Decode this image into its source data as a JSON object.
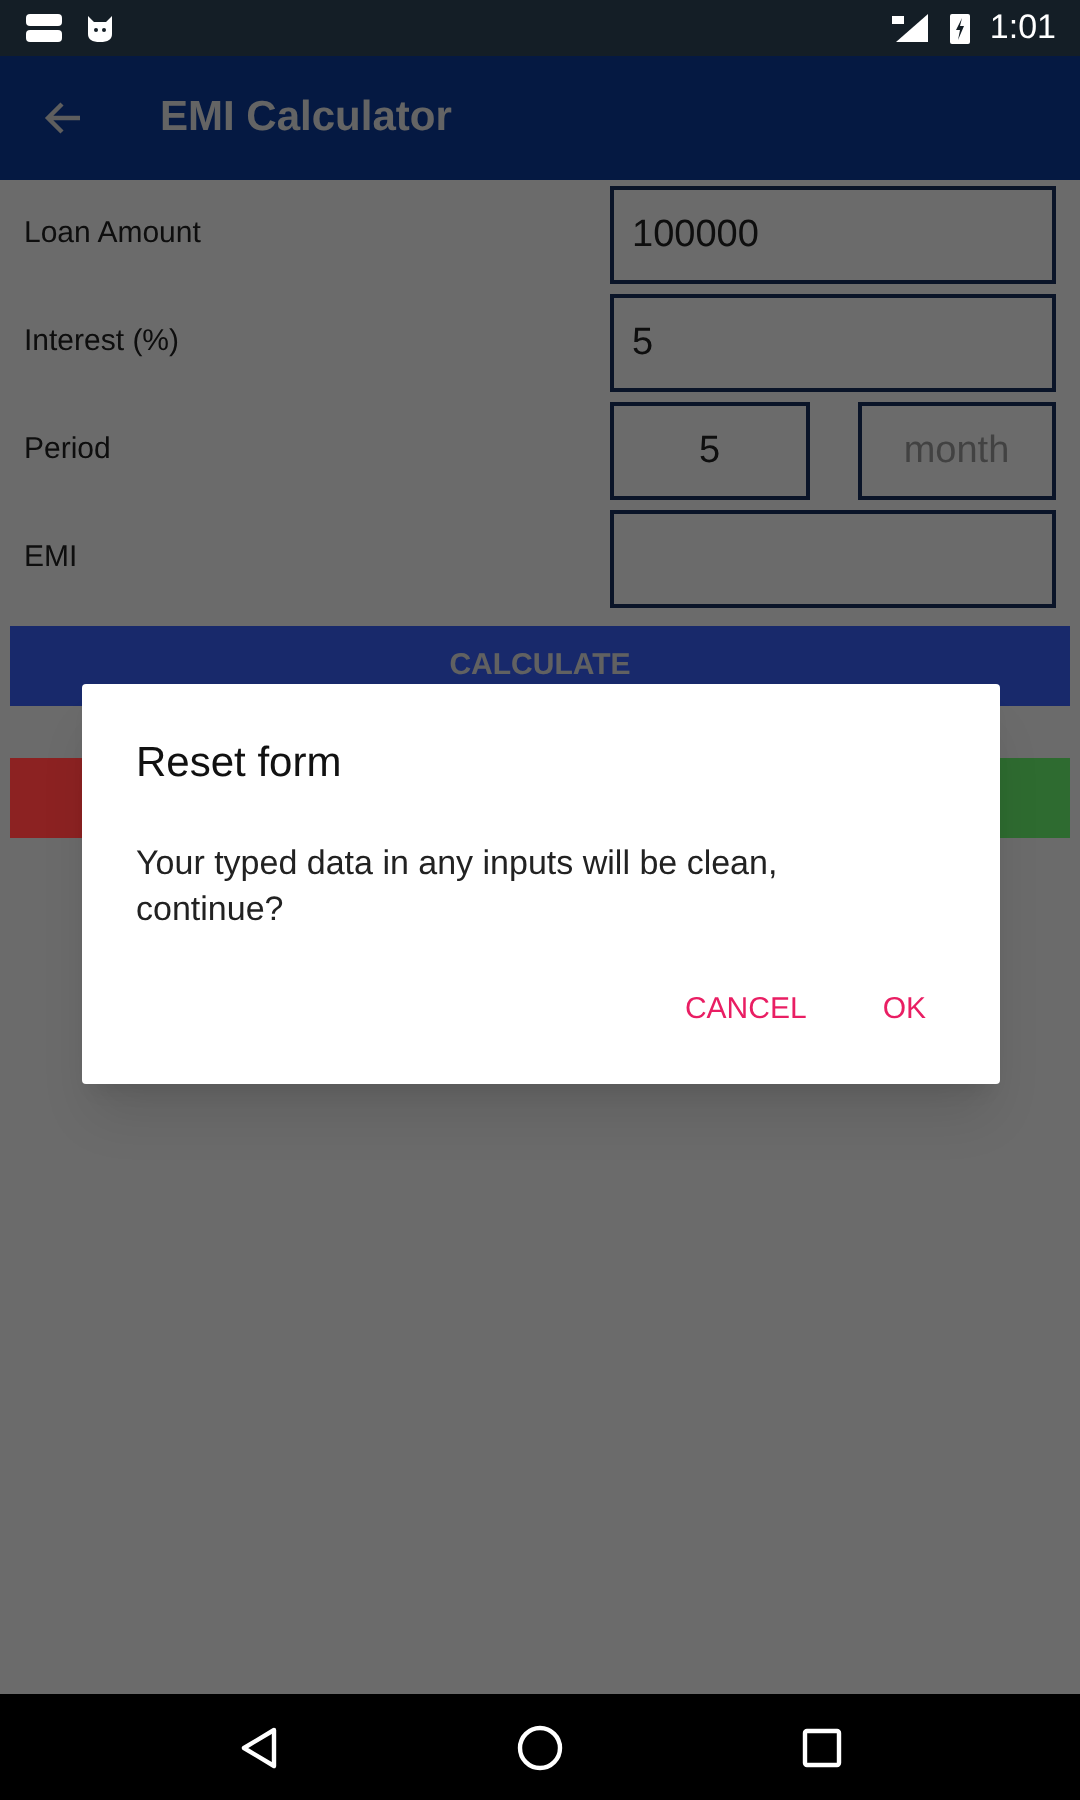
{
  "status_bar": {
    "time": "1:01"
  },
  "app_bar": {
    "title": "EMI Calculator"
  },
  "form": {
    "rows": [
      {
        "label": "Loan Amount",
        "fields": [
          {
            "kind": "entry",
            "value": "100000"
          }
        ]
      },
      {
        "label": "Interest (%)",
        "fields": [
          {
            "kind": "entry",
            "value": "5"
          }
        ]
      },
      {
        "label": "Period",
        "fields": [
          {
            "kind": "entry",
            "value": "5"
          },
          {
            "kind": "entry",
            "placeholder": "month"
          }
        ]
      },
      {
        "label": "EMI",
        "fields": [
          {
            "kind": "entry"
          }
        ]
      }
    ]
  },
  "calculate_button": {
    "label": "CALCULATE"
  },
  "lower_buttons": [
    {
      "color": "#8c2222"
    },
    {
      "color": "#2e6b30"
    }
  ],
  "dialog": {
    "title": "Reset form",
    "message": "Your typed data in any inputs will be clean, continue?",
    "actions": [
      {
        "label": "CANCEL"
      },
      {
        "label": "OK"
      }
    ]
  }
}
